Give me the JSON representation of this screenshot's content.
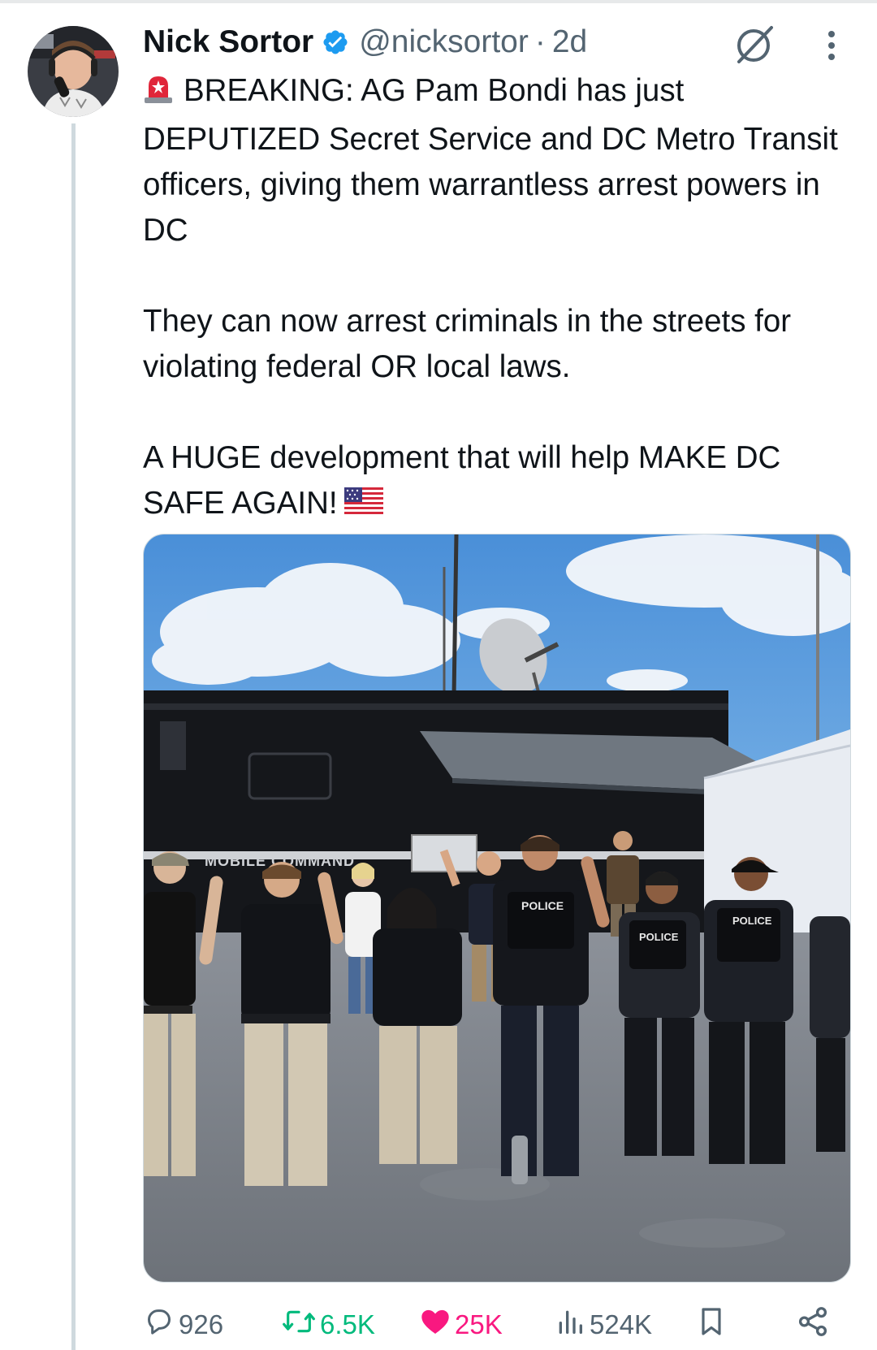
{
  "tweet": {
    "display_name": "Nick Sortor",
    "handle": "@nicksortor",
    "separator": "·",
    "time": "2d",
    "verified": true,
    "text": {
      "para1": "BREAKING: AG Pam Bondi has just DEPUTIZED Secret Service and DC Metro Transit officers, giving them warrantless arrest powers in DC",
      "para2": "They can now arrest criminals in the streets for violating federal OR local laws.",
      "para3": "A HUGE development that will help MAKE DC SAFE AGAIN!"
    },
    "emoji": {
      "siren": "police-car-light-emoji",
      "flag": "us-flag-emoji"
    },
    "media": {
      "vehicle_text": "MOBILE COMMAND",
      "vest_text": "POLICE"
    },
    "stats": {
      "replies": "926",
      "reposts": "6.5K",
      "likes": "25K",
      "views": "524K"
    },
    "icons": {
      "grok": "grok-icon",
      "more": "more-options-icon",
      "reply": "reply-icon",
      "repost": "repost-icon",
      "like": "heart-icon",
      "views": "views-icon",
      "bookmark": "bookmark-icon",
      "share": "share-icon"
    }
  },
  "colors": {
    "text": "#0f1419",
    "secondary": "#536471",
    "verified": "#1d9bf0",
    "repost": "#00ba7c",
    "like": "#f91880",
    "thread_line": "#cfd9de"
  }
}
